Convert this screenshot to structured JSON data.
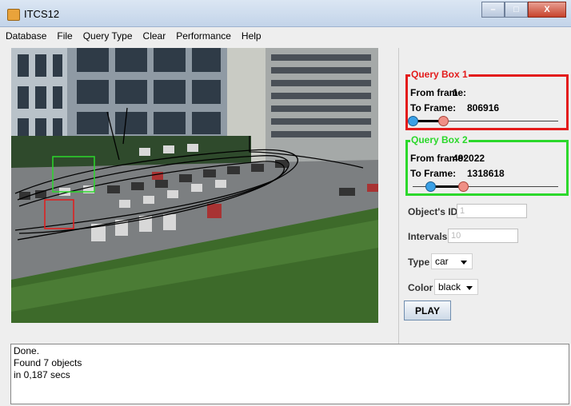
{
  "window": {
    "title": "ITCS12",
    "minimize": "–",
    "maximize": "□",
    "close": "X"
  },
  "menu": [
    "Database",
    "File",
    "Query Type",
    "Clear",
    "Performance",
    "Help"
  ],
  "query_box_1": {
    "title": "Query Box 1",
    "from_label": "From frame:",
    "from_value": "1",
    "to_label": "To Frame:",
    "to_value": "806916"
  },
  "query_box_2": {
    "title": "Query Box 2",
    "from_label": "From frame:",
    "from_value": "492022",
    "to_label": "To Frame:",
    "to_value": "1318618"
  },
  "form": {
    "object_id_label": "Object's ID",
    "object_id_placeholder": "1",
    "intervals_label": "Intervals",
    "intervals_placeholder": "10",
    "type_label": "Type",
    "type_value": "car",
    "color_label": "Color",
    "color_value": "black",
    "play_label": "PLAY"
  },
  "status": {
    "lines": [
      "Done.",
      "Found 7 objects",
      "in 0,187 secs"
    ]
  },
  "colors": {
    "query_box_1": "#e31b1b",
    "query_box_2": "#2bd82b"
  },
  "icons": {
    "app": "app-icon",
    "dropdown": "chevron-down-icon"
  }
}
